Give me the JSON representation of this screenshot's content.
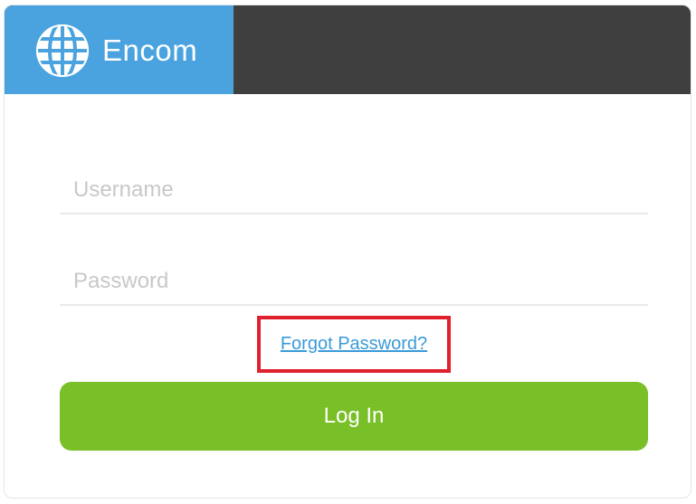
{
  "brand": {
    "name": "Encom",
    "logo_icon": "globe-icon",
    "color": "#4aa3df"
  },
  "header": {
    "color": "#3f3f3f"
  },
  "form": {
    "username": {
      "placeholder": "Username",
      "value": ""
    },
    "password": {
      "placeholder": "Password",
      "value": ""
    },
    "forgot_password_label": "Forgot Password?",
    "login_label": "Log In",
    "login_color": "#79bf27",
    "highlight_color": "#e0202c"
  }
}
